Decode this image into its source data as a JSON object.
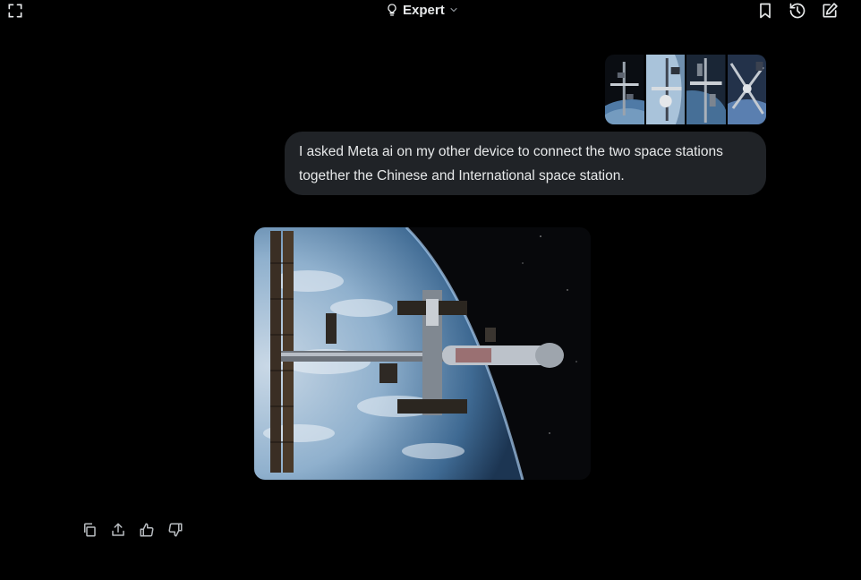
{
  "header": {
    "mode_label": "Expert",
    "icons": [
      "fullscreen-icon",
      "lightbulb-icon",
      "chevron-down-icon",
      "bookmark-icon",
      "history-icon",
      "new-chat-icon"
    ]
  },
  "conversation": {
    "user_message": {
      "attachment_count": 4,
      "text": "I asked Meta ai on my other device to connect the two space stations together the Chinese and International space station."
    },
    "assistant_response": {
      "image_alt": "Generated image of a combined space station orbiting above Earth"
    }
  },
  "actions": [
    "copy-icon",
    "share-icon",
    "thumbs-up-icon",
    "thumbs-down-icon"
  ]
}
